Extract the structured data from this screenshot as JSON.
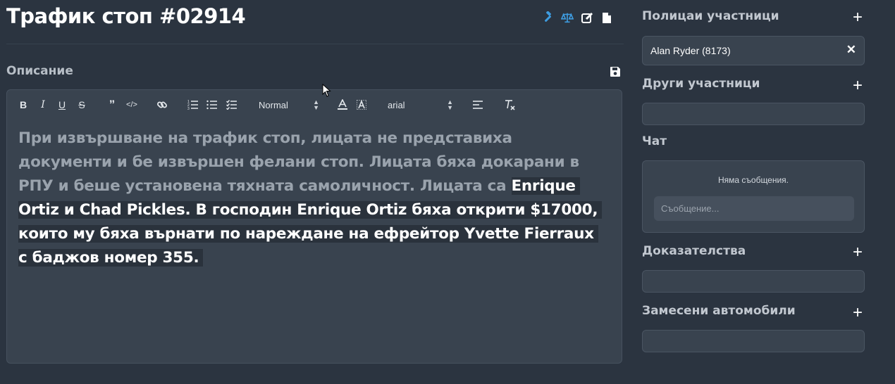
{
  "header": {
    "title": "Трафик стоп #02914",
    "icons": [
      "gavel-icon",
      "scale-icon",
      "edit-icon",
      "file-icon"
    ]
  },
  "description": {
    "label": "Описание",
    "toolbar": {
      "header_select": "Normal",
      "font_select": "arial"
    },
    "text_muted": "При извършване на трафик стоп, лицата не представиха документи и бе извършен фелани стоп. Лицата бяха докарани в РПУ и беше установена тяхната самоличност. Лицата са ",
    "text_highlight": "Enrique Ortiz и Chad Pickles. В господин Enrique Ortiz бяха открити $17000, които му бяха върнати по нареждане на ефрейтор Yvette Fierraux с баджов номер 355."
  },
  "sidebar": {
    "police_title": "Полицаи участници",
    "police_items": [
      {
        "name": "Alan Ryder (8173)"
      }
    ],
    "others_title": "Други участници",
    "chat_title": "Чат",
    "chat_empty": "Няма съобщения.",
    "chat_placeholder": "Съобщение...",
    "evidence_title": "Доказателства",
    "vehicles_title": "Замесени автомобили",
    "plus_symbol": "+",
    "remove_symbol": "✕"
  },
  "colors": {
    "background": "#2b3440",
    "panel": "#39434f",
    "accent_blue": "#3e9ce0"
  }
}
